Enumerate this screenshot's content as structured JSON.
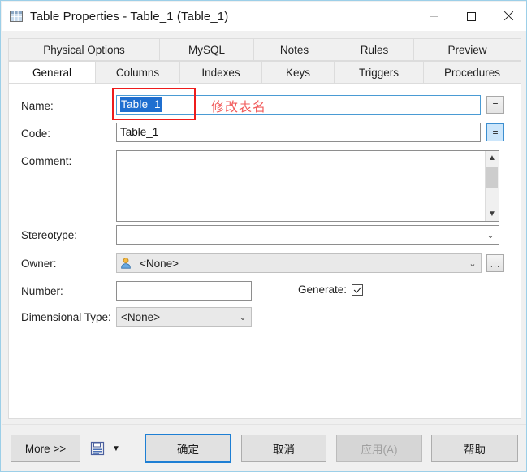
{
  "window": {
    "title": "Table Properties - Table_1 (Table_1)",
    "icon": "table-grid-icon",
    "controls": {
      "minimize": "minimize-icon",
      "maximize": "maximize-icon",
      "close": "close-icon"
    }
  },
  "tabs": {
    "row1": [
      {
        "label": "Physical Options",
        "selected": false,
        "width": 187
      },
      {
        "label": "MySQL",
        "selected": false,
        "width": 116
      },
      {
        "label": "Notes",
        "selected": false,
        "width": 100
      },
      {
        "label": "Rules",
        "selected": false,
        "width": 97
      },
      {
        "label": "Preview",
        "selected": false,
        "width": 132
      }
    ],
    "row2": [
      {
        "label": "General",
        "selected": true,
        "width": 108
      },
      {
        "label": "Columns",
        "selected": false,
        "width": 104
      },
      {
        "label": "Indexes",
        "selected": false,
        "width": 101
      },
      {
        "label": "Keys",
        "selected": false,
        "width": 89
      },
      {
        "label": "Triggers",
        "selected": false,
        "width": 110
      },
      {
        "label": "Procedures",
        "selected": false,
        "width": 120
      }
    ]
  },
  "form": {
    "name": {
      "label": "Name:",
      "value": "Table_1",
      "selected": true,
      "equals_button": "=",
      "equals_active": false
    },
    "code": {
      "label": "Code:",
      "value": "Table_1",
      "equals_button": "=",
      "equals_active": true
    },
    "comment": {
      "label": "Comment:",
      "value": "",
      "scroll_up": "▲",
      "scroll_down": "▼"
    },
    "stereotype": {
      "label": "Stereotype:",
      "value": "",
      "caret": "⌄"
    },
    "owner": {
      "label": "Owner:",
      "value": "<None>",
      "icon": "user-icon",
      "caret": "⌄",
      "browse_button": "..."
    },
    "number": {
      "label": "Number:",
      "value": ""
    },
    "generate": {
      "label": "Generate:",
      "checked": true
    },
    "dimensional_type": {
      "label": "Dimensional Type:",
      "value": "<None>",
      "caret": "⌄"
    }
  },
  "annotation": {
    "text": "修改表名",
    "box_color": "#ee1c1c",
    "text_color": "#f15b5b"
  },
  "footer": {
    "more": "More >>",
    "save_icon": "save-icon",
    "save_dropdown": "▼",
    "ok": "确定",
    "cancel": "取消",
    "apply": "应用(A)",
    "help": "帮助"
  },
  "colors": {
    "accent": "#1e7fd4",
    "selection": "#1f6fd0",
    "window_border": "#9ccfe8",
    "annotation": "#ee1c1c"
  }
}
